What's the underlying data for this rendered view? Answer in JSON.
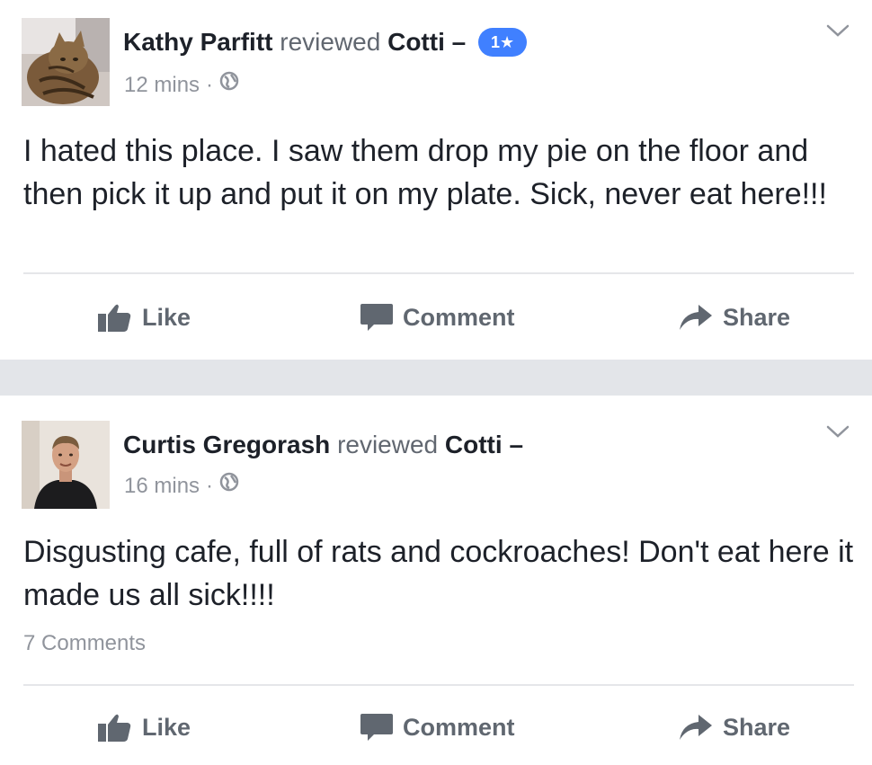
{
  "posts": [
    {
      "author": "Kathy Parfitt",
      "verb": "reviewed",
      "page": "Cotti",
      "dash": "–",
      "rating": "1★",
      "time": "12 mins",
      "separator": "·",
      "privacy_icon": "globe-icon",
      "text": "I hated this place. I saw them drop my pie on the floor and then pick it up and put it on my plate. Sick, never eat here!!!",
      "comments": "",
      "actions": {
        "like": "Like",
        "comment": "Comment",
        "share": "Share"
      }
    },
    {
      "author": "Curtis Gregorash",
      "verb": "reviewed",
      "page": "Cotti",
      "dash": "–",
      "time": "16 mins",
      "separator": "·",
      "privacy_icon": "globe-icon",
      "text": "Disgusting cafe, full of rats and cockroaches! Don't eat here it made us all sick!!!!",
      "comments": "7 Comments",
      "actions": {
        "like": "Like",
        "comment": "Comment",
        "share": "Share"
      }
    }
  ],
  "colors": {
    "rating_badge": "#4080ff",
    "action_text": "#606770",
    "meta_text": "#90949c",
    "separator_band": "#e3e5e9"
  }
}
